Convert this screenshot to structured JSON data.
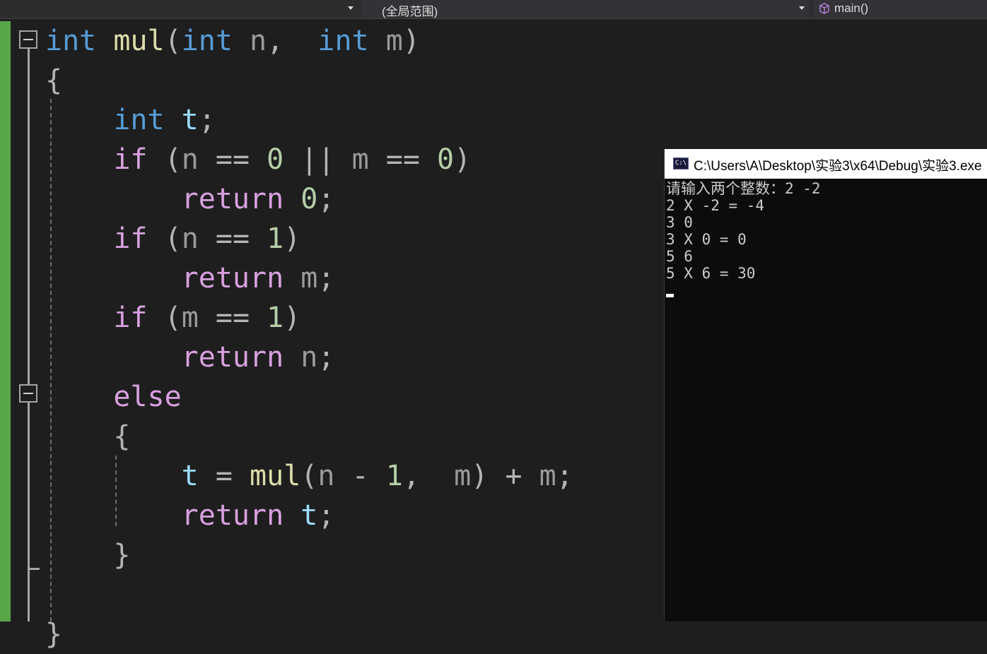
{
  "navbar": {
    "scope_label": "(全局范围)",
    "member_label": "main()"
  },
  "editor": {
    "lines": [
      [
        {
          "t": "int",
          "c": "kw"
        },
        {
          "t": " "
        },
        {
          "t": "mul",
          "c": "fn"
        },
        {
          "t": "(",
          "c": "op"
        },
        {
          "t": "int",
          "c": "kw"
        },
        {
          "t": " "
        },
        {
          "t": "n",
          "c": "par"
        },
        {
          "t": ",",
          "c": "op"
        },
        {
          "t": "  "
        },
        {
          "t": "int",
          "c": "kw"
        },
        {
          "t": " "
        },
        {
          "t": "m",
          "c": "par"
        },
        {
          "t": ")",
          "c": "op"
        }
      ],
      [
        {
          "t": "{",
          "c": "op"
        }
      ],
      [
        {
          "t": "    "
        },
        {
          "t": "int",
          "c": "kw"
        },
        {
          "t": " "
        },
        {
          "t": "t",
          "c": "loc"
        },
        {
          "t": ";",
          "c": "op"
        }
      ],
      [
        {
          "t": "    "
        },
        {
          "t": "if",
          "c": "ctl"
        },
        {
          "t": " "
        },
        {
          "t": "(",
          "c": "op"
        },
        {
          "t": "n",
          "c": "par"
        },
        {
          "t": " "
        },
        {
          "t": "==",
          "c": "op"
        },
        {
          "t": " "
        },
        {
          "t": "0",
          "c": "num"
        },
        {
          "t": " "
        },
        {
          "t": "||",
          "c": "op"
        },
        {
          "t": " "
        },
        {
          "t": "m",
          "c": "par"
        },
        {
          "t": " "
        },
        {
          "t": "==",
          "c": "op"
        },
        {
          "t": " "
        },
        {
          "t": "0",
          "c": "num"
        },
        {
          "t": ")",
          "c": "op"
        }
      ],
      [
        {
          "t": "        "
        },
        {
          "t": "return",
          "c": "ctl"
        },
        {
          "t": " "
        },
        {
          "t": "0",
          "c": "num"
        },
        {
          "t": ";",
          "c": "op"
        }
      ],
      [
        {
          "t": "    "
        },
        {
          "t": "if",
          "c": "ctl"
        },
        {
          "t": " "
        },
        {
          "t": "(",
          "c": "op"
        },
        {
          "t": "n",
          "c": "par"
        },
        {
          "t": " "
        },
        {
          "t": "==",
          "c": "op"
        },
        {
          "t": " "
        },
        {
          "t": "1",
          "c": "num"
        },
        {
          "t": ")",
          "c": "op"
        }
      ],
      [
        {
          "t": "        "
        },
        {
          "t": "return",
          "c": "ctl"
        },
        {
          "t": " "
        },
        {
          "t": "m",
          "c": "par"
        },
        {
          "t": ";",
          "c": "op"
        }
      ],
      [
        {
          "t": "    "
        },
        {
          "t": "if",
          "c": "ctl"
        },
        {
          "t": " "
        },
        {
          "t": "(",
          "c": "op"
        },
        {
          "t": "m",
          "c": "par"
        },
        {
          "t": " "
        },
        {
          "t": "==",
          "c": "op"
        },
        {
          "t": " "
        },
        {
          "t": "1",
          "c": "num"
        },
        {
          "t": ")",
          "c": "op"
        }
      ],
      [
        {
          "t": "        "
        },
        {
          "t": "return",
          "c": "ctl"
        },
        {
          "t": " "
        },
        {
          "t": "n",
          "c": "par"
        },
        {
          "t": ";",
          "c": "op"
        }
      ],
      [
        {
          "t": "    "
        },
        {
          "t": "else",
          "c": "ctl"
        }
      ],
      [
        {
          "t": "    "
        },
        {
          "t": "{",
          "c": "op"
        }
      ],
      [
        {
          "t": "        "
        },
        {
          "t": "t",
          "c": "loc"
        },
        {
          "t": " "
        },
        {
          "t": "=",
          "c": "op"
        },
        {
          "t": " "
        },
        {
          "t": "mul",
          "c": "fn"
        },
        {
          "t": "(",
          "c": "op"
        },
        {
          "t": "n",
          "c": "par"
        },
        {
          "t": " "
        },
        {
          "t": "-",
          "c": "op"
        },
        {
          "t": " "
        },
        {
          "t": "1",
          "c": "num"
        },
        {
          "t": ",",
          "c": "op"
        },
        {
          "t": "  "
        },
        {
          "t": "m",
          "c": "par"
        },
        {
          "t": ")",
          "c": "op"
        },
        {
          "t": " "
        },
        {
          "t": "+",
          "c": "op"
        },
        {
          "t": " "
        },
        {
          "t": "m",
          "c": "par"
        },
        {
          "t": ";",
          "c": "op"
        }
      ],
      [
        {
          "t": "        "
        },
        {
          "t": "return",
          "c": "ctl"
        },
        {
          "t": " "
        },
        {
          "t": "t",
          "c": "loc"
        },
        {
          "t": ";",
          "c": "op"
        }
      ],
      [
        {
          "t": "    "
        },
        {
          "t": "}",
          "c": "op"
        }
      ],
      [],
      [
        {
          "t": "}",
          "c": "op"
        }
      ]
    ]
  },
  "console": {
    "title": "C:\\Users\\A\\Desktop\\实验3\\x64\\Debug\\实验3.exe",
    "icon_text": "C:\\",
    "lines": [
      "请输入两个整数：2 -2",
      "2 X -2 = -4",
      "3 0",
      "3 X 0 = 0",
      "5 6",
      "5 X 6 = 30"
    ]
  }
}
